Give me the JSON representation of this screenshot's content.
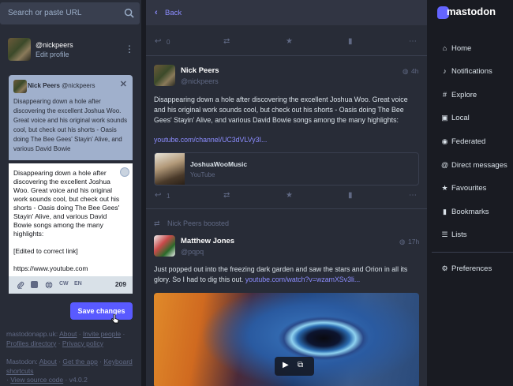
{
  "search": {
    "placeholder": "Search or paste URL"
  },
  "profile": {
    "handle": "@nickpeers",
    "edit_label": "Edit profile"
  },
  "reply_to": {
    "name": "Nick Peers",
    "acct": "@nickpeers",
    "text": "Disappearing down a hole after discovering the excellent Joshua Woo. Great voice and his original work sounds cool, but check out his shorts - Oasis doing The Bee Gees' Stayin' Alive, and various David Bowie"
  },
  "compose": {
    "text": "Disappearing down a hole after discovering the excellent Joshua Woo. Great voice and his original work sounds cool, but check out his shorts - Oasis doing The Bee Gees' Stayin' Alive, and various David Bowie songs among the many highlights:\n\n[Edited to correct link]\n\nhttps://www.youtube.com",
    "cw_label": "CW",
    "lang_label": "EN",
    "char_count": "209",
    "save_label": "Save changes"
  },
  "footer": {
    "l1a": "mastodonapp.uk:",
    "about": "About",
    "invite": "Invite people",
    "profiles": "Profiles directory",
    "privacy": "Privacy policy",
    "l2a": "Mastodon:",
    "about2": "About",
    "getapp": "Get the app",
    "keyboard": "Keyboard shortcuts",
    "source": "View source code",
    "version": "v4.0.2"
  },
  "header": {
    "back_label": "Back"
  },
  "top_actions": {
    "reply_count": "0"
  },
  "post1": {
    "name": "Nick Peers",
    "acct": "@nickpeers",
    "time": "4h",
    "text": "Disappearing down a hole after discovering the excellent Joshua Woo. Great voice and his original work sounds cool, but check out his shorts - Oasis doing The Bee Gees' Stayin' Alive, and various David Bowie songs among the many highlights:",
    "link": "youtube.com/channel/UC3dVLVy3I...",
    "card_title": "JoshuaWooMusic",
    "card_source": "YouTube",
    "reply_count": "1"
  },
  "boost": {
    "label": "Nick Peers boosted"
  },
  "post2": {
    "name": "Matthew Jones",
    "acct": "@pqpq",
    "time": "17h",
    "text": "Just popped out into the freezing dark garden and saw the stars and Orion in all its glory. So I had to dig this out.",
    "link": "youtube.com/watch?v=wzamXSv3li..."
  },
  "nav": {
    "brand": "mastodon",
    "items": [
      "Home",
      "Notifications",
      "Explore",
      "Local",
      "Federated",
      "Direct messages",
      "Favourites",
      "Bookmarks",
      "Lists"
    ],
    "preferences": "Preferences"
  },
  "colors": {
    "accent": "#595aff",
    "link": "#8c8dff",
    "bg_dark": "#191b22",
    "bg_panel": "#282c37"
  }
}
